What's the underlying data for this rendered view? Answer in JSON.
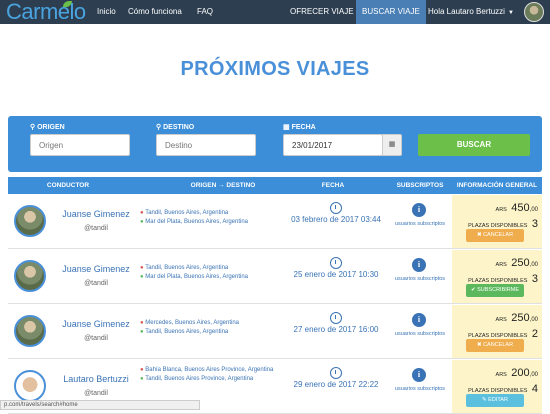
{
  "nav": {
    "logo": "Carmelo",
    "links": [
      "Inicio",
      "Cómo funciona",
      "FAQ"
    ],
    "offer": "OFRECER VIAJE",
    "search": "BUSCAR VIAJE",
    "user": "Hola Lautaro Bertuzzi"
  },
  "page_title": "PRÓXIMOS VIAJES",
  "search": {
    "origin_label": "ORIGEN",
    "origin_placeholder": "Origen",
    "dest_label": "DESTINO",
    "dest_placeholder": "Destino",
    "date_label": "FECHA",
    "date_value": "23/01/2017",
    "button": "BUSCAR"
  },
  "table": {
    "headers": [
      "CONDUCTOR",
      "ORIGEN → DESTINO",
      "FECHA",
      "SUBSCRIPTOS",
      "INFORMACIÓN GENERAL"
    ],
    "rows": [
      {
        "name": "Juanse Gimenez",
        "handle": "@tandil",
        "origin": "Tandil, Buenos Aires, Argentina",
        "destination": "Mar del Plata, Buenos Aires, Argentina",
        "date": "03 febrero de 2017 03:44",
        "subs": "usuarios subscriptos",
        "currency": "ARS",
        "price": "450",
        "cents": ",00",
        "plazas_label": "PLAZAS DISPONIBLES",
        "plazas": "3",
        "action": "✖ CANCELAR"
      },
      {
        "name": "Juanse Gimenez",
        "handle": "@tandil",
        "origin": "Tandil, Buenos Aires, Argentina",
        "destination": "Mar del Plata, Buenos Aires, Argentina",
        "date": "25 enero de 2017 10:30",
        "subs": "usuarios subscriptos",
        "currency": "ARS",
        "price": "250",
        "cents": ",00",
        "plazas_label": "PLAZAS DISPONIBLES",
        "plazas": "3",
        "action": "✔ SUBSCRIBIRME"
      },
      {
        "name": "Juanse Gimenez",
        "handle": "@tandil",
        "origin": "Mercedes, Buenos Aires, Argentina",
        "destination": "Tandil, Buenos Aires, Argentina",
        "date": "27 enero de 2017 16:00",
        "subs": "usuarios subscriptos",
        "currency": "ARS",
        "price": "250",
        "cents": ",00",
        "plazas_label": "PLAZAS DISPONIBLES",
        "plazas": "2",
        "action": "✖ CANCELAR"
      },
      {
        "name": "Lautaro Bertuzzi",
        "handle": "@tandil",
        "origin": "Bahía Blanca, Buenos Aires Province, Argentina",
        "destination": "Tandil, Buenos Aires Province, Argentina",
        "date": "29 enero de 2017 22:22",
        "subs": "usuarios subscriptos",
        "currency": "ARS",
        "price": "200",
        "cents": ",00",
        "plazas_label": "PLAZAS DISPONIBLES",
        "plazas": "4",
        "action": "✎ EDITAR"
      }
    ]
  },
  "status_url": "p.com/travels/search#home",
  "colors": {
    "nav_bg": "#2c3e50",
    "primary": "#3d8ed8",
    "accent_green": "#6cc04a",
    "warn": "#f0ad4e",
    "info_bg": "#fdf5c9"
  }
}
